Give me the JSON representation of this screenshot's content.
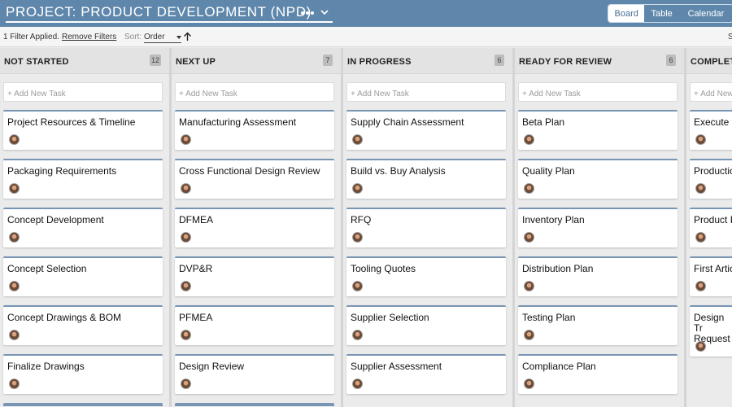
{
  "header": {
    "title": "PROJECT: PRODUCT DEVELOPMENT (NPD)",
    "views": [
      {
        "label": "Board",
        "active": true
      },
      {
        "label": "Table",
        "active": false
      },
      {
        "label": "Calendar",
        "active": false
      }
    ]
  },
  "filter_bar": {
    "applied_text": "1 Filter Applied.",
    "remove_filters": "Remove Filters",
    "sort_label": "Sort:",
    "sort_value": "Order",
    "right_text": "S"
  },
  "columns": [
    {
      "name": "NOT STARTED",
      "count": "12",
      "add_placeholder": "+ Add New Task",
      "cards": [
        "Project Resources & Timeline",
        "Packaging Requirements",
        "Concept Development",
        "Concept Selection",
        "Concept Drawings & BOM",
        "Finalize Drawings"
      ]
    },
    {
      "name": "NEXT UP",
      "count": "7",
      "add_placeholder": "+ Add New Task",
      "cards": [
        "Manufacturing Assessment",
        "Cross Functional Design Review",
        "DFMEA",
        "DVP&R",
        "PFMEA",
        "Design Review"
      ]
    },
    {
      "name": "IN PROGRESS",
      "count": "6",
      "add_placeholder": "+ Add New Task",
      "cards": [
        "Supply Chain Assessment",
        "Build vs. Buy Analysis",
        "RFQ",
        "Tooling Quotes",
        "Supplier Selection",
        "Supplier Assessment"
      ]
    },
    {
      "name": "READY FOR REVIEW",
      "count": "6",
      "add_placeholder": "+ Add New Task",
      "cards": [
        "Beta Plan",
        "Quality Plan",
        "Inventory Plan",
        "Distribution Plan",
        "Testing Plan",
        "Compliance Plan"
      ]
    },
    {
      "name": "COMPLET",
      "count": "",
      "add_placeholder": "+ Add New",
      "cards": [
        "Execute B",
        "Productio",
        "Product F",
        "First Artic",
        "Design Tr Request"
      ]
    }
  ],
  "colors": {
    "header_bg": "#5f87ac",
    "card_accent": "#7895b4",
    "board_bg": "#ebebeb"
  },
  "icons": {
    "title_dropdown": "chevron-down-icon",
    "more": "more-horizontal-icon",
    "sort_direction": "arrow-up-icon",
    "assignee": "avatar"
  }
}
